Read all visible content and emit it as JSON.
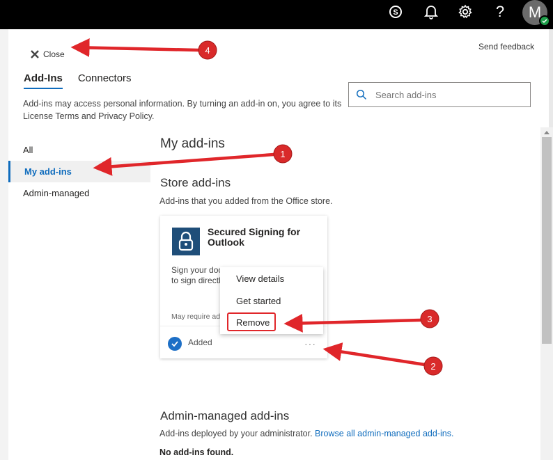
{
  "topbar": {
    "icons": [
      "skype-icon",
      "bell-icon",
      "gear-icon",
      "help-icon"
    ],
    "help_glyph": "?",
    "avatar_initial": "M"
  },
  "panel": {
    "close_label": "Close",
    "feedback_label": "Send feedback",
    "tabs": [
      {
        "label": "Add-Ins",
        "active": true
      },
      {
        "label": "Connectors",
        "active": false
      }
    ],
    "search_placeholder": "Search add-ins",
    "disclaimer": "Add-ins may access personal information. By turning an add-in on, you agree to its License Terms and Privacy Policy.",
    "nav": [
      {
        "label": "All"
      },
      {
        "label": "My add-ins",
        "active": true
      },
      {
        "label": "Admin-managed"
      }
    ]
  },
  "content": {
    "heading": "My add-ins",
    "store_heading": "Store add-ins",
    "store_sub": "Add-ins that you added from the Office store.",
    "card": {
      "title": "Secured Signing for Outlook",
      "desc_visible": "Sign your docu",
      "desc_line2": "to sign directly",
      "note": "May require addi",
      "status": "Added",
      "more": "···"
    },
    "menu": [
      "View details",
      "Get started",
      "Remove"
    ],
    "admin_heading": "Admin-managed add-ins",
    "admin_sub": "Add-ins deployed by your administrator.",
    "admin_link": "Browse all admin-managed add-ins.",
    "none_found": "No add-ins found."
  },
  "callouts": [
    "1",
    "2",
    "3",
    "4"
  ],
  "colors": {
    "accent": "#0f6cbd",
    "arrow": "#e0262a"
  }
}
